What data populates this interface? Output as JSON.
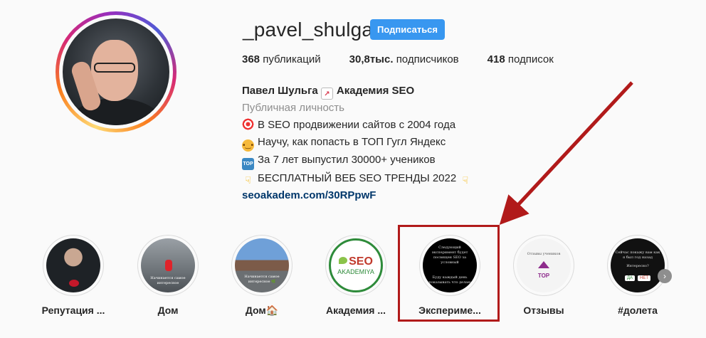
{
  "profile": {
    "username": "_pavel_shulga",
    "follow_label": "Подписаться",
    "stats": [
      {
        "count": "368",
        "label": "публикаций"
      },
      {
        "count": "30,8тыс.",
        "label": "подписчиков"
      },
      {
        "count": "418",
        "label": "подписок"
      }
    ]
  },
  "bio": {
    "name": "Павел Шульга",
    "name_suffix": "Академия SEO",
    "category": "Публичная личность",
    "lines": [
      {
        "icon": "target-emoji",
        "text": "В SEO продвижении сайтов с 2004 года"
      },
      {
        "icon": "face-emoji",
        "text": "Научу, как попасть в ТОП Гугл Яндекс"
      },
      {
        "icon": "top-emoji",
        "text": "За 7 лет выпустил 30000+ учеников"
      },
      {
        "icon": "pointing-down-emoji",
        "text": "БЕСПЛАТНЫЙ ВЕБ SEO ТРЕНДЫ 2022"
      }
    ],
    "link": "seoakadem.com/30RPpwF"
  },
  "highlights": [
    {
      "label": "Репутация ..."
    },
    {
      "label": "Дом"
    },
    {
      "label": "Дом🏠"
    },
    {
      "label": "Академия ..."
    },
    {
      "label": "Экспериме..."
    },
    {
      "label": "Отзывы"
    },
    {
      "label": "#долета"
    }
  ],
  "highlight_thumbs": {
    "dom": "Начинается самое интересное",
    "dom2": "Начинается самое интересное 🌿",
    "seo_title": "SEO",
    "seo_sub": "AKADEMIYA",
    "exp_top": "Следующий эксперимент будет посвящен SEO за условный",
    "exp_bottom": "Буду каждый день показывать что делаю",
    "otzyvy_text": "Отзывы учеников",
    "otzyvy_top": "TOP",
    "doleta_text": "Сейчас покажу вам как я был год назад",
    "doleta_q": "Интересно?",
    "doleta_yes": "ДА",
    "doleta_no": "НЕТ"
  },
  "next_icon": "chevron-right-icon",
  "colors": {
    "follow_button": "#3897f0",
    "link": "#00376b",
    "annotation": "#b11a1a"
  }
}
